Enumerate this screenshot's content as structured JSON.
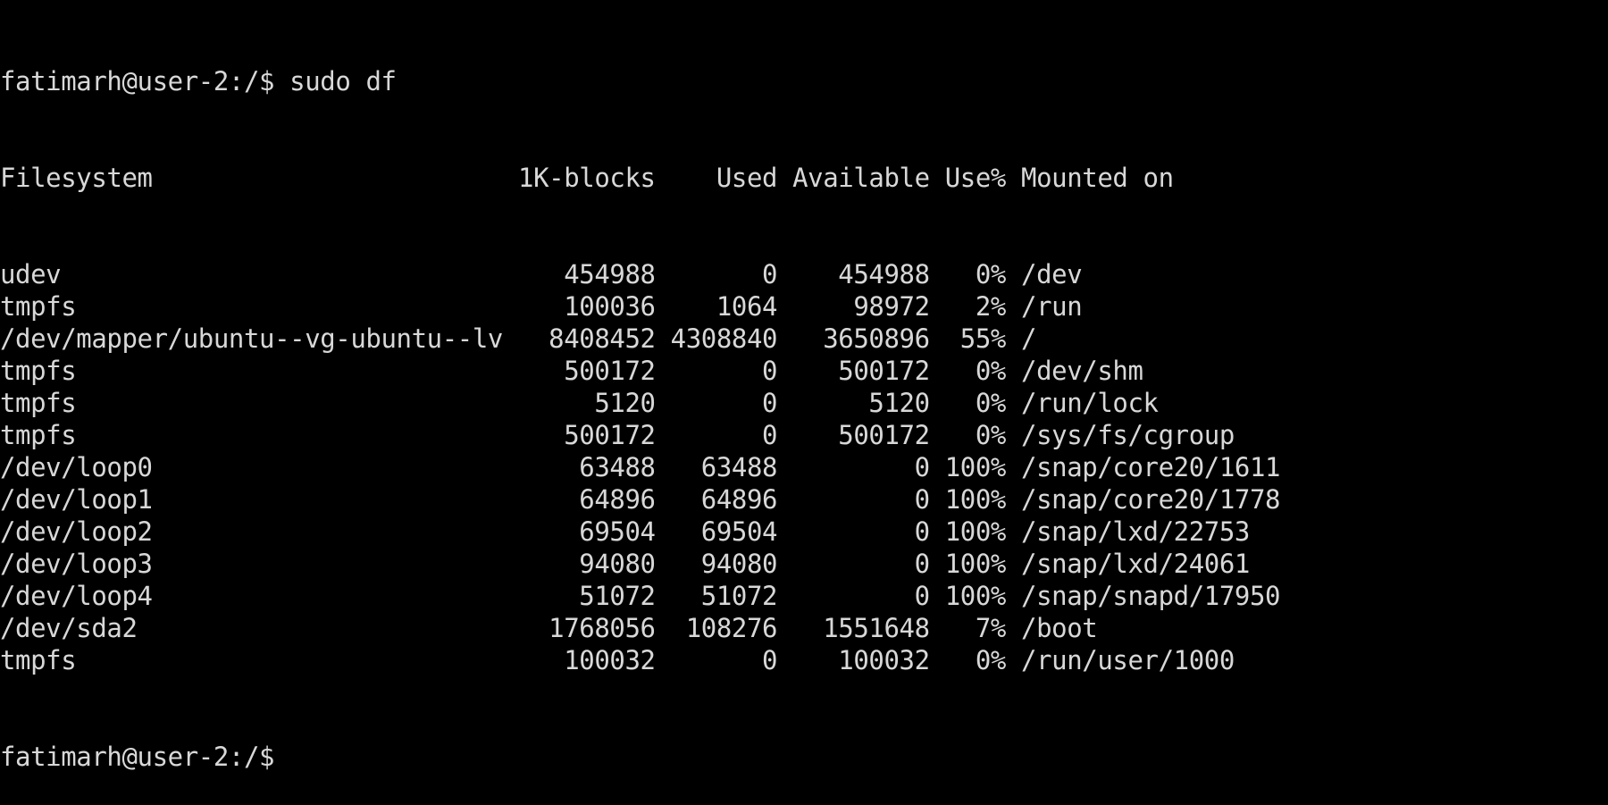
{
  "prompt": "fatimarh@user-2:/$",
  "command": "sudo df",
  "headers": [
    "Filesystem",
    "1K-blocks",
    "Used",
    "Available",
    "Use%",
    "Mounted on"
  ],
  "rows": [
    [
      "udev",
      "454988",
      "0",
      "454988",
      "0%",
      "/dev"
    ],
    [
      "tmpfs",
      "100036",
      "1064",
      "98972",
      "2%",
      "/run"
    ],
    [
      "/dev/mapper/ubuntu--vg-ubuntu--lv",
      "8408452",
      "4308840",
      "3650896",
      "55%",
      "/"
    ],
    [
      "tmpfs",
      "500172",
      "0",
      "500172",
      "0%",
      "/dev/shm"
    ],
    [
      "tmpfs",
      "5120",
      "0",
      "5120",
      "0%",
      "/run/lock"
    ],
    [
      "tmpfs",
      "500172",
      "0",
      "500172",
      "0%",
      "/sys/fs/cgroup"
    ],
    [
      "/dev/loop0",
      "63488",
      "63488",
      "0",
      "100%",
      "/snap/core20/1611"
    ],
    [
      "/dev/loop1",
      "64896",
      "64896",
      "0",
      "100%",
      "/snap/core20/1778"
    ],
    [
      "/dev/loop2",
      "69504",
      "69504",
      "0",
      "100%",
      "/snap/lxd/22753"
    ],
    [
      "/dev/loop3",
      "94080",
      "94080",
      "0",
      "100%",
      "/snap/lxd/24061"
    ],
    [
      "/dev/loop4",
      "51072",
      "51072",
      "0",
      "100%",
      "/snap/snapd/17950"
    ],
    [
      "/dev/sda2",
      "1768056",
      "108276",
      "1551648",
      "7%",
      "/boot"
    ],
    [
      "tmpfs",
      "100032",
      "0",
      "100032",
      "0%",
      "/run/user/1000"
    ]
  ],
  "final_prompt": "fatimarh@user-2:/$"
}
